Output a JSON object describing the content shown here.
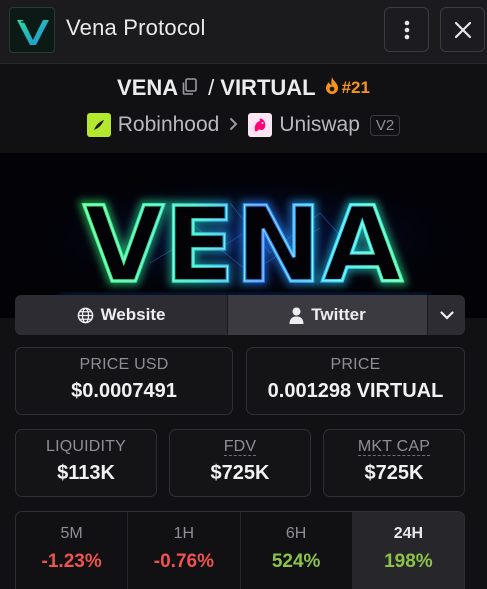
{
  "header": {
    "title": "Vena Protocol",
    "menu_icon": "vertical-dots-icon",
    "close_icon": "close-icon"
  },
  "pair": {
    "base": "VENA",
    "separator": "/",
    "quote": "VIRTUAL",
    "rank": "#21",
    "rank_color": "#f7931a"
  },
  "route": {
    "chain": "Robinhood",
    "dex": "Uniswap",
    "version": "V2"
  },
  "banner": {
    "text": "VENA"
  },
  "links": {
    "website": "Website",
    "twitter": "Twitter"
  },
  "stats": {
    "price_usd": {
      "label": "PRICE USD",
      "value": "$0.0007491"
    },
    "price": {
      "label": "PRICE",
      "value": "0.001298 VIRTUAL"
    },
    "liquidity": {
      "label": "LIQUIDITY",
      "value": "$113K"
    },
    "fdv": {
      "label": "FDV",
      "value": "$725K"
    },
    "mkt_cap": {
      "label": "MKT CAP",
      "value": "$725K"
    }
  },
  "timeframes": [
    {
      "label": "5M",
      "change": "-1.23%",
      "direction": "negative"
    },
    {
      "label": "1H",
      "change": "-0.76%",
      "direction": "negative"
    },
    {
      "label": "6H",
      "change": "524%",
      "direction": "positive"
    },
    {
      "label": "24H",
      "change": "198%",
      "direction": "positive",
      "selected": true
    }
  ],
  "colors": {
    "negative": "#ef5350",
    "positive": "#8bc34a",
    "accent": "#f7931a"
  }
}
